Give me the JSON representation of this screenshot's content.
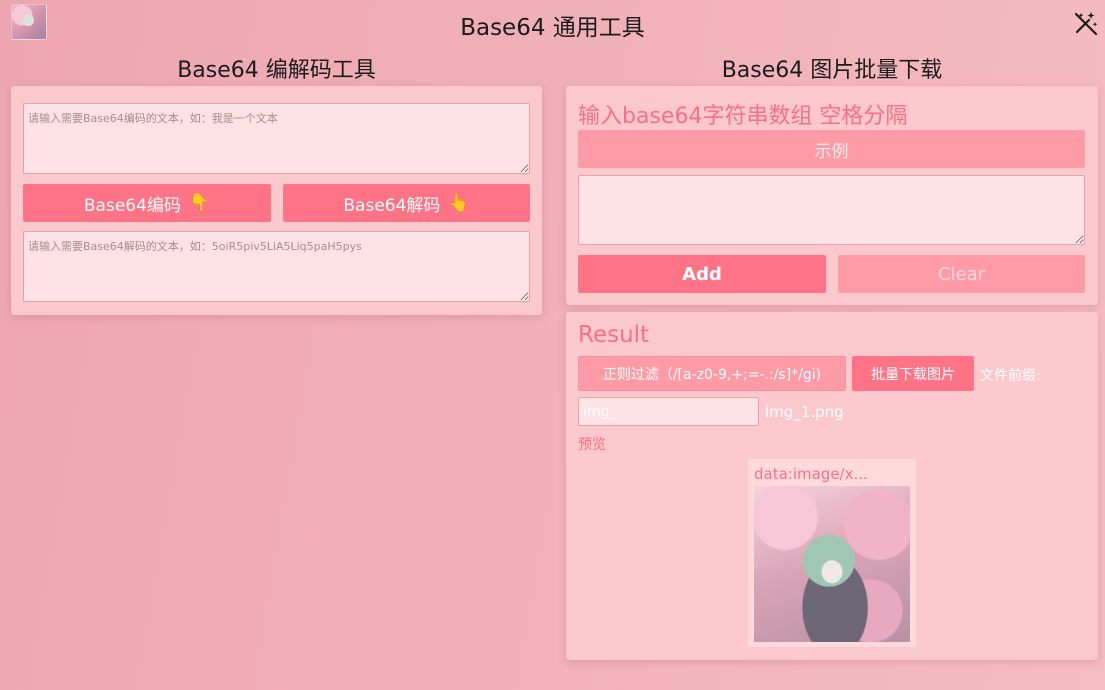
{
  "header": {
    "title": "Base64 通用工具",
    "avatar_icon": "avatar-image",
    "theme_icon": "magic-wand-off-icon"
  },
  "encoder": {
    "title": "Base64 编解码工具",
    "encode_placeholder": "请输入需要Base64编码的文本，如：我是一个文本",
    "decode_placeholder": "请输入需要Base64解码的文本，如：5oiR5piv5LiA5Liq5paH5pys",
    "encode_label": "Base64编码",
    "decode_label": "Base64解码",
    "encode_hand": "👇",
    "decode_hand": "👆"
  },
  "image_tool": {
    "title": "Base64 图片批量下载",
    "input_heading": "输入base64字符串数组 空格分隔",
    "example_label": "示例",
    "array_value": "",
    "add_label": "Add",
    "clear_label": "Clear"
  },
  "result": {
    "heading": "Result",
    "regex_label": "正则过滤（/[a-z0-9,+;=-.:/s]*/gi)",
    "batch_download_label": "批量下载图片",
    "prefix_label": "文件前缀:",
    "prefix_value": "img_",
    "filename": "img_1.png",
    "preview_label": "预览",
    "thumb_caption": "data:image/x..."
  },
  "colors": {
    "accent": "#ff7387",
    "accent_soft": "#fe9ba6",
    "card_bg": "#fbc9cd",
    "heading_pink": "#fb6f84"
  }
}
